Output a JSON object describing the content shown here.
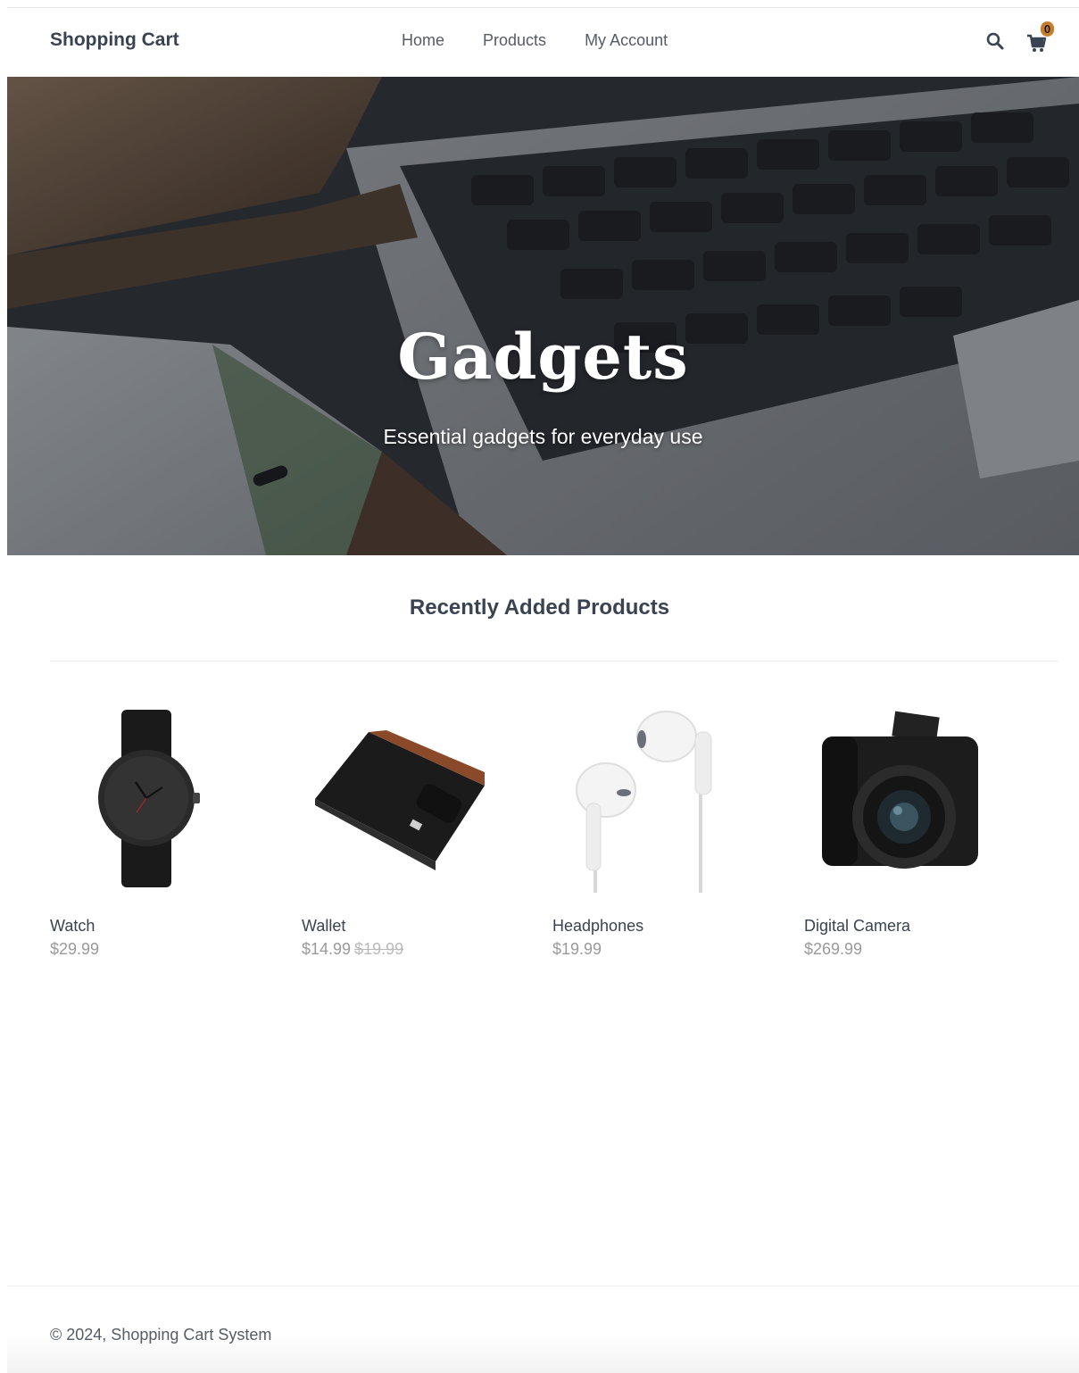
{
  "header": {
    "brand": "Shopping Cart",
    "nav": [
      {
        "label": "Home"
      },
      {
        "label": "Products"
      },
      {
        "label": "My Account"
      }
    ],
    "cart_count": "0",
    "search_icon": "search-icon",
    "cart_icon": "shopping-cart-icon"
  },
  "hero": {
    "title": "Gadgets",
    "subtitle": "Essential gadgets for everyday use"
  },
  "section": {
    "title": "Recently Added Products"
  },
  "products": [
    {
      "name": "Watch",
      "price": "$29.99",
      "rrp": ""
    },
    {
      "name": "Wallet",
      "price": "$14.99",
      "rrp": "$19.99"
    },
    {
      "name": "Headphones",
      "price": "$19.99",
      "rrp": ""
    },
    {
      "name": "Digital Camera",
      "price": "$269.99",
      "rrp": ""
    }
  ],
  "footer": {
    "copyright": "© 2024, Shopping Cart System"
  },
  "colors": {
    "text": "#394352",
    "price": "#9a9a9a",
    "badge": "#c77c2c"
  }
}
